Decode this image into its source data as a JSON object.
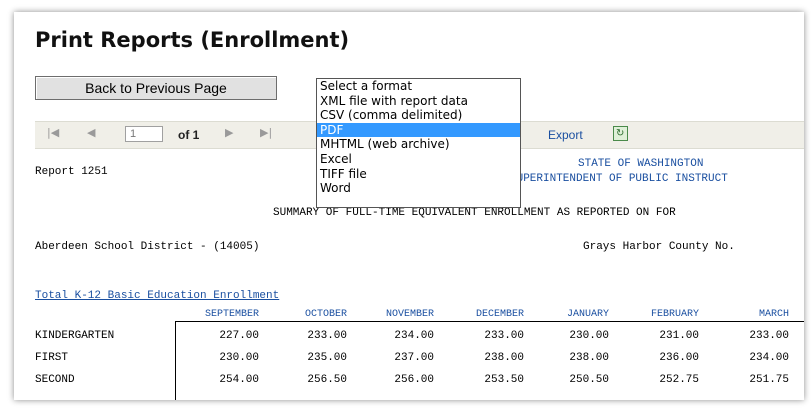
{
  "page": {
    "title": "Print Reports (Enrollment)",
    "back_button": "Back to Previous Page"
  },
  "toolbar": {
    "first_icon": "first-page-icon",
    "prev_icon": "previous-page-icon",
    "page_value": "1",
    "of_text": "of 1",
    "next_icon": "next-page-icon",
    "last_icon": "last-page-icon",
    "export_label": "Export",
    "refresh_icon": "refresh-icon"
  },
  "format_dropdown": {
    "options": [
      "Select a format",
      "XML file with report data",
      "CSV (comma delimited)",
      "PDF",
      "MHTML (web archive)",
      "Excel",
      "TIFF file",
      "Word"
    ],
    "selected": "PDF"
  },
  "report": {
    "report_id": "Report 1251",
    "agency_line1": "STATE OF WASHINGTON",
    "agency_line2": "SUPERINTENDENT OF PUBLIC INSTRUCT",
    "summary": "SUMMARY OF FULL-TIME EQUIVALENT ENROLLMENT AS REPORTED ON FOR",
    "district": "Aberdeen School District - (14005)",
    "county": "Grays Harbor County No.",
    "section_title": "Total K-12 Basic Education Enrollment",
    "months": [
      "SEPTEMBER",
      "OCTOBER",
      "NOVEMBER",
      "DECEMBER",
      "JANUARY",
      "FEBRUARY",
      "MARCH"
    ],
    "rows": [
      {
        "grade": "KINDERGARTEN",
        "values": [
          "227.00",
          "233.00",
          "234.00",
          "233.00",
          "230.00",
          "231.00",
          "233.00"
        ]
      },
      {
        "grade": "FIRST",
        "values": [
          "230.00",
          "235.00",
          "237.00",
          "238.00",
          "238.00",
          "236.00",
          "234.00"
        ]
      },
      {
        "grade": "SECOND",
        "values": [
          "254.00",
          "256.50",
          "256.00",
          "253.50",
          "250.50",
          "252.75",
          "251.75"
        ]
      }
    ]
  },
  "colors": {
    "link_blue": "#1a4fa0",
    "toolbar_bg": "#f0efe8",
    "selected_option": "#3399ff"
  }
}
